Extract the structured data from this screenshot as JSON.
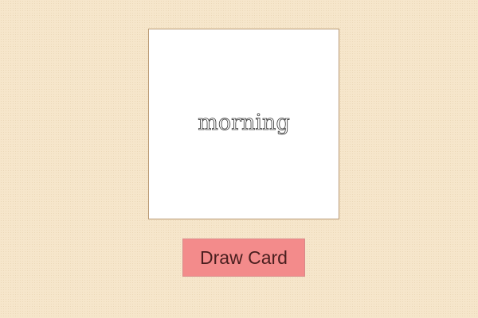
{
  "card": {
    "word": "morning"
  },
  "controls": {
    "draw_label": "Draw Card"
  },
  "colors": {
    "background": "#f6e6cb",
    "card_background": "#ffffff",
    "card_border": "#b89873",
    "button_background": "#f38b8b",
    "button_text": "#4a1f1f"
  }
}
